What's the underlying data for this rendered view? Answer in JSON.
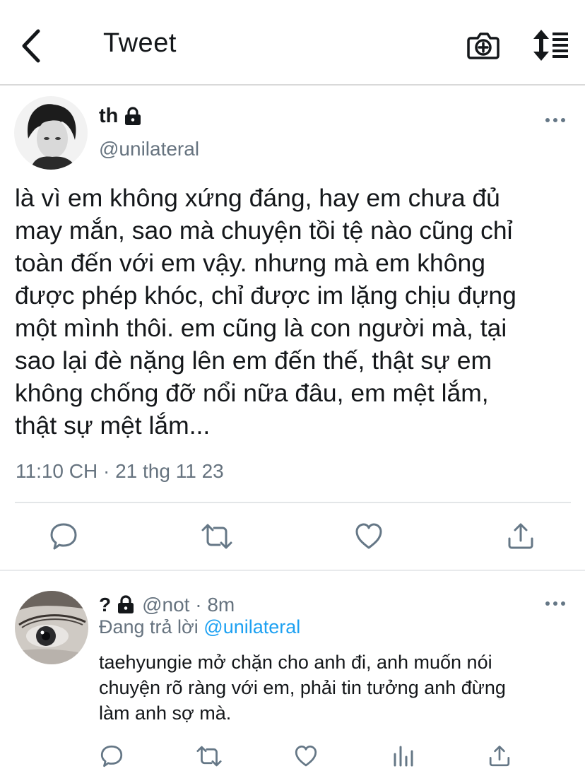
{
  "header": {
    "title": "Tweet"
  },
  "tweet": {
    "name": "th",
    "handle": "@unilateral",
    "text_lines": [
      "là vì em không xứng đáng, hay em chưa đủ",
      "may mắn, sao mà chuyện tồi tệ nào cũng chỉ",
      "toàn đến với em vậy. nhưng mà em không",
      "được phép khóc, chỉ được im lặng chịu đựng",
      "một mình thôi. em cũng là con người mà, tại",
      "sao lại đè nặng lên em đến thế, thật sự em",
      "không chống đỡ nổi nữa đâu, em mệt lắm,",
      "thật sự mệt lắm..."
    ],
    "timestamp": "11:10 CH · 21 thg 11 23"
  },
  "reply": {
    "name": "?",
    "meta": "@not · 8m",
    "replying_prefix": "Đang trả lời",
    "replying_to": "@unilateral",
    "text_lines": [
      "taehyungie mở chặn cho anh đi, anh muốn nói",
      "chuyện rõ ràng với em, phải tin tưởng anh đừng",
      "làm anh sợ mà."
    ]
  },
  "icons": {
    "back": "chevron-left-icon",
    "camera": "camera-plus-icon",
    "sort": "sort-icon",
    "lock": "lock-icon",
    "more": "more-horizontal-icon",
    "reply": "comment-icon",
    "retweet": "retweet-icon",
    "like": "heart-icon",
    "share": "share-icon",
    "analytics": "analytics-icon"
  },
  "colors": {
    "link": "#1da1f2",
    "secondary_text": "#66737f",
    "icon": "#657786"
  }
}
